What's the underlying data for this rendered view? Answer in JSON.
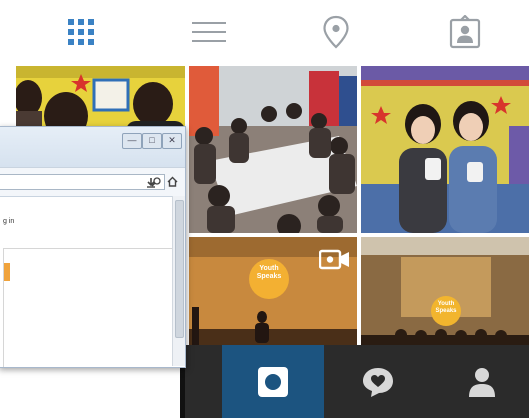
{
  "toolbar": {
    "grid_icon": "grid-icon",
    "list_icon": "list-icon",
    "location_icon": "location-pin-icon",
    "profile_tag_icon": "tagged-photos-icon",
    "active_color": "#3b82c4",
    "inactive_color": "#9aa0a6"
  },
  "photos": [
    {
      "name": "photo-people-at-laptops"
    },
    {
      "name": "photo-workshop-tables"
    },
    {
      "name": "photo-two-women-holding-robots"
    },
    {
      "name": "photo-stage-youth-speaks",
      "video_icon": "video-camera-icon",
      "stage_banner": "Youth Speaks"
    },
    {
      "name": "photo-auditorium-youth-speaks",
      "stage_banner": "Youth Speaks"
    }
  ],
  "bottom_nav": {
    "items": [
      {
        "icon": "home-feed-icon",
        "active": true
      },
      {
        "icon": "activity-heart-bubble-icon",
        "active": false
      },
      {
        "icon": "profile-icon",
        "active": false
      }
    ],
    "background": "#2b2b2b",
    "active_background": "#1c5480"
  },
  "browser_window": {
    "controls": [
      "minimize",
      "restore",
      "close"
    ],
    "snippet_text": "g in",
    "toolbar_icons": [
      "search-icon",
      "download-arrow-icon",
      "home-icon"
    ]
  }
}
